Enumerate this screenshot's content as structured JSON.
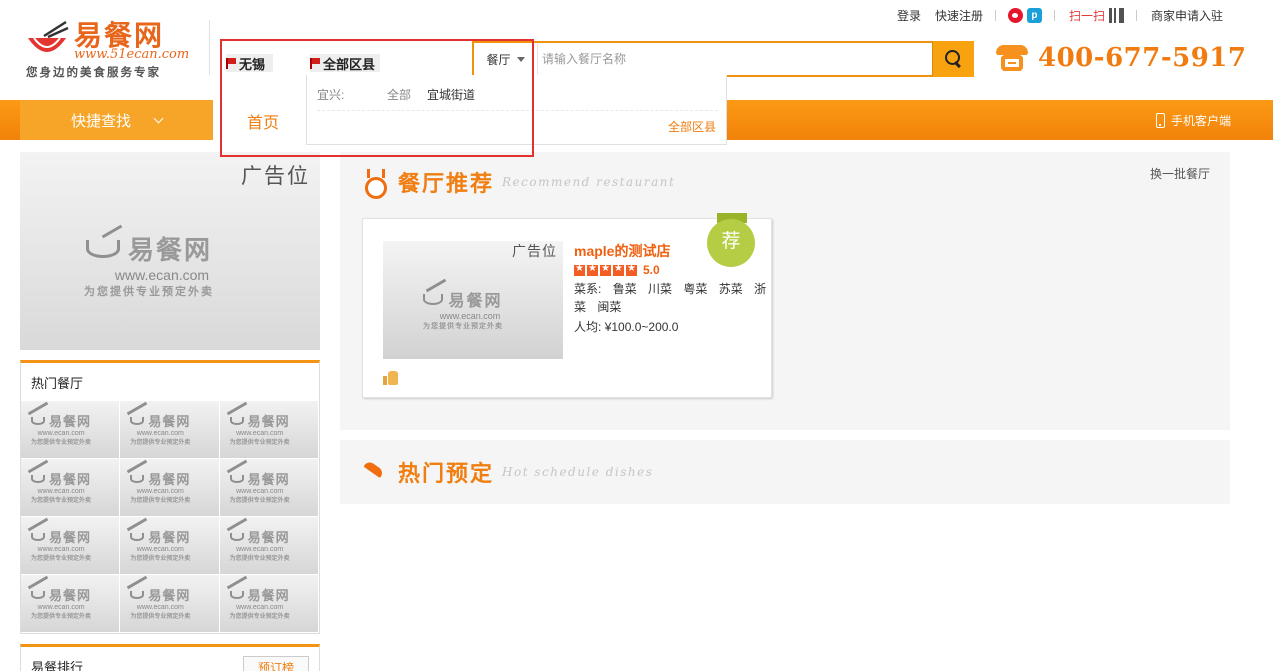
{
  "header": {
    "logo": {
      "name": "易餐网",
      "url": "www.51ecan.com",
      "slogan": "您身边的美食服务专家"
    },
    "top_links": {
      "login": "登录",
      "register": "快速注册",
      "scan": "扫一扫",
      "merchant": "商家申请入驻"
    },
    "city": "无锡",
    "district": "全部区县",
    "search": {
      "type": "餐厅",
      "placeholder": "请输入餐厅名称"
    },
    "hotline": "400-677-5917"
  },
  "nav": {
    "quick_find": "快捷查找",
    "home": "首页",
    "mobile": "手机客户端"
  },
  "district_dropdown": {
    "area_label": "宜兴:",
    "all_option": "全部",
    "street": "宜城街道",
    "all_districts": "全部区县"
  },
  "sidebar": {
    "ad_label": "广告位",
    "watermark": {
      "name": "易餐网",
      "url": "www.ecan.com",
      "slogan": "为您提供专业预定外卖"
    },
    "hot_title": "热门餐厅",
    "rank_title": "易餐排行",
    "rank_button": "预订榜"
  },
  "recommend": {
    "title": "餐厅推荐",
    "subtitle": "Recommend restaurant",
    "more": "换一批餐厅",
    "restaurant": {
      "ad_label": "广告位",
      "name": "maple的测试店",
      "rating": "5.0",
      "stars": 5,
      "cuisine_label": "菜系:",
      "cuisines": [
        "鲁菜",
        "川菜",
        "粤菜",
        "苏菜",
        "浙菜",
        "闽菜"
      ],
      "avg_label": "人均:",
      "avg_price": "¥100.0~200.0",
      "badge": "荐"
    }
  },
  "booking": {
    "title": "热门预定",
    "subtitle": "Hot schedule dishes"
  },
  "colors": {
    "accent": "#f58a0b",
    "highlight": "#e23131",
    "badge": "#b4cd45",
    "star": "#f35c22"
  }
}
